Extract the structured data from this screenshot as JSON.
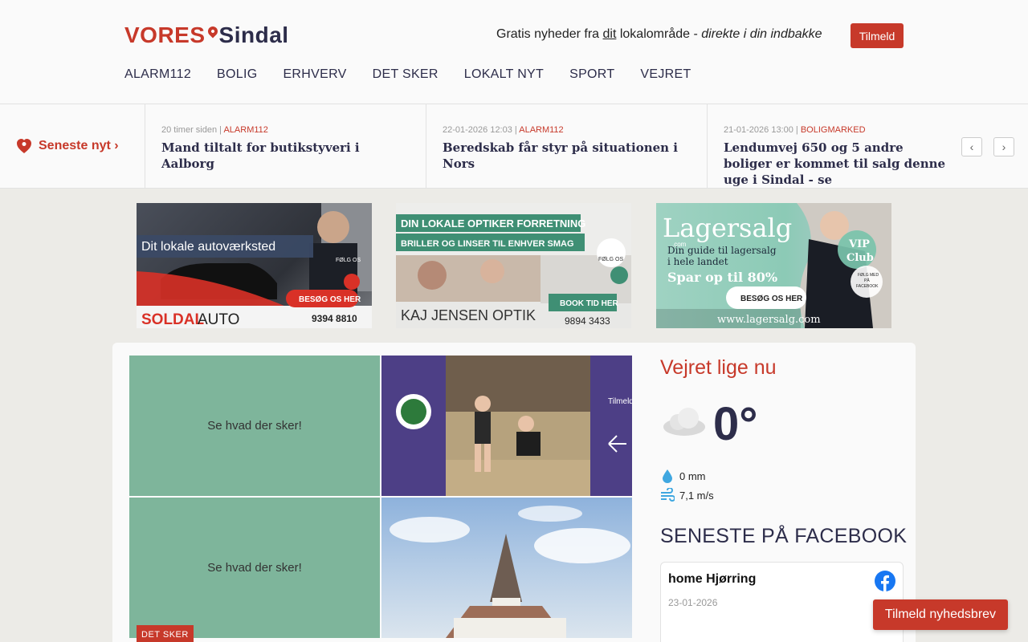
{
  "header": {
    "logo_prefix": "VORES",
    "logo_town": "Sindal",
    "tagline_start": "Gratis nyheder fra ",
    "tagline_dit": "dit",
    "tagline_mid": " lokalområde - ",
    "tagline_em": "direkte i din indbakke",
    "subscribe_label": "Tilmeld"
  },
  "nav": [
    "ALARM112",
    "BOLIG",
    "ERHVERV",
    "DET SKER",
    "LOKALT NYT",
    "SPORT",
    "VEJRET"
  ],
  "ticker": {
    "label": "Seneste nyt ›",
    "items": [
      {
        "time": "20 timer siden",
        "category": "ALARM112",
        "title": "Mand tiltalt for butikstyveri i Aalborg"
      },
      {
        "time": "22-01-2026 12:03",
        "category": "ALARM112",
        "title": "Beredskab får styr på situationen i Nors"
      },
      {
        "time": "21-01-2026 13:00",
        "category": "BOLIGMARKED",
        "title": "Lendumvej 650 og 5 andre boliger er kommet til salg denne uge i Sindal - se"
      }
    ],
    "prev": "‹",
    "next": "›"
  },
  "ads": [
    {
      "headline": "Dit lokale autoværksted",
      "brand": "SOLDAL",
      "brand2": "AUTO",
      "cta": "BESØG OS HER",
      "phone": "9394 8810",
      "follow": "FØLG OS"
    },
    {
      "line1": "DIN LOKALE OPTIKER FORRETNING",
      "line2": "BRILLER OG LINSER TIL ENHVER SMAG",
      "brand": "KAJ JENSEN OPTIK",
      "cta": "BOOK TID HER",
      "phone": "9894 3433",
      "follow": "FØLG OS"
    },
    {
      "brand": "Lagersalg",
      "brand_sub": ".com",
      "line1": "Din guide til lagersalg",
      "line2": "i hele landet",
      "line3": "Spar op til 80%",
      "cta": "BESØG OS HER",
      "url": "www.lagersalg.com",
      "vip1": "VIP",
      "vip2": "Club",
      "follow1": "FØLG MED",
      "follow2": "PÅ",
      "follow3": "FACEBOOK"
    }
  ],
  "tiles": {
    "t1": "Se hvad der sker!",
    "t2_side": "Tilmeld prøvetim",
    "t3": "Se hvad der sker!",
    "badge": "DET SKER"
  },
  "weather": {
    "title": "Vejret lige nu",
    "temp": "0°",
    "rain": "0 mm",
    "wind": "7,1 m/s"
  },
  "facebook": {
    "title": "SENESTE PÅ FACEBOOK",
    "name": "home Hjørring",
    "date": "23-01-2026"
  },
  "floating_cta": "Tilmeld nyhedsbrev",
  "colors": {
    "accent": "#c7392a",
    "navy": "#2d2d4a"
  }
}
